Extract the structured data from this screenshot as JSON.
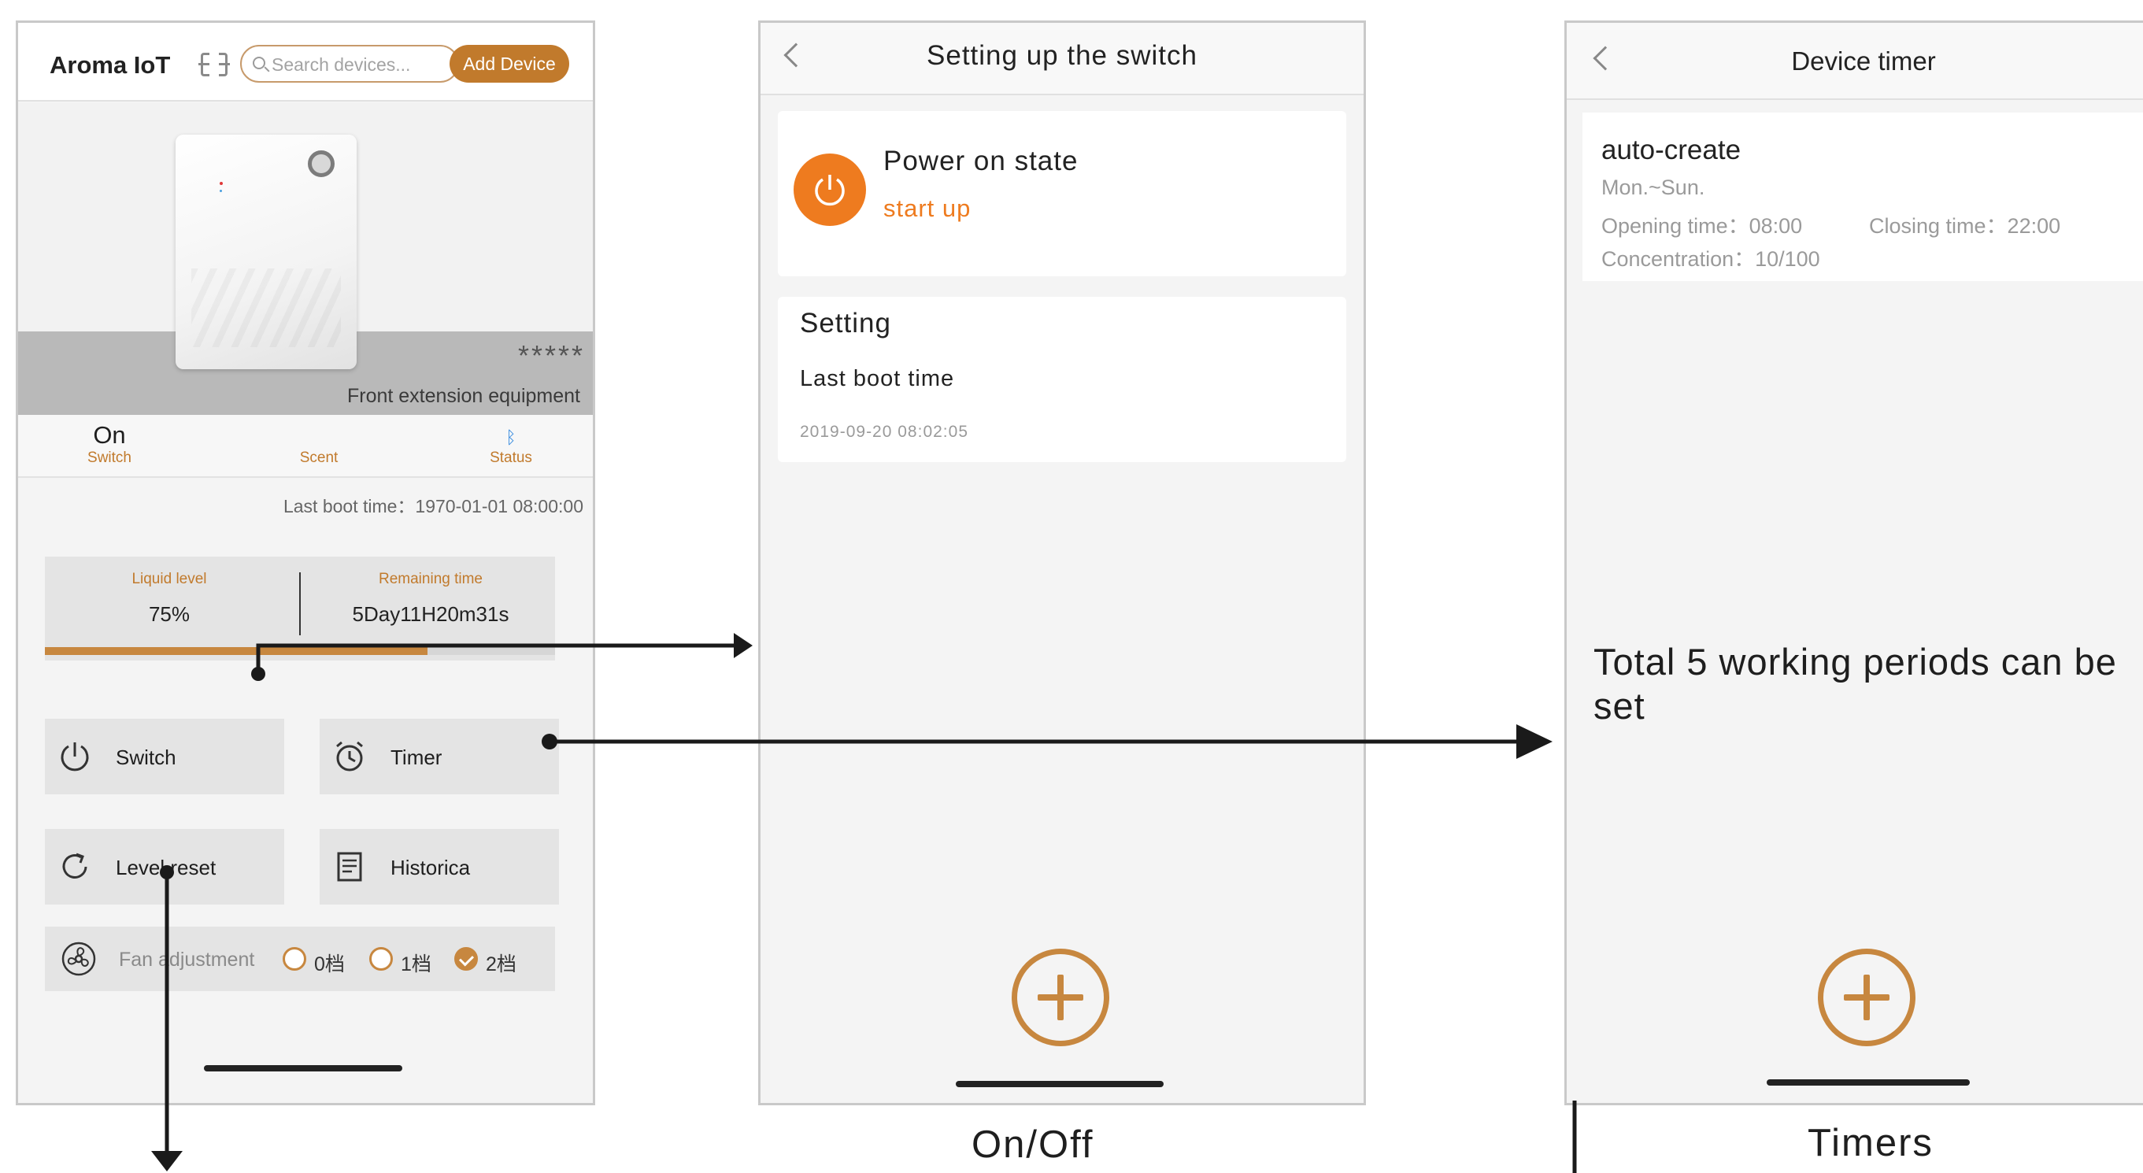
{
  "phone1": {
    "app_title": "Aroma IoT",
    "search_placeholder": "Search devices...",
    "add_device_label": "Add Device",
    "device_stars": "*****",
    "device_subtitle": "Front extension equipment",
    "tabs": [
      {
        "value": "On",
        "label": "Switch"
      },
      {
        "value": "",
        "label": "Scent"
      },
      {
        "icon": "bluetooth-icon",
        "label": "Status"
      }
    ],
    "last_boot_text": "Last boot time：1970-01-01 08:00:00",
    "liquid_level_label": "Liquid level",
    "liquid_level_value": "75%",
    "liquid_level_fraction": 0.75,
    "remaining_time_label": "Remaining time",
    "remaining_time_value": "5Day11H20m31s",
    "buttons": {
      "switch": "Switch",
      "timer": "Timer",
      "level_reset": "Level reset",
      "historica": "Historica"
    },
    "fan": {
      "label": "Fan adjustment",
      "options": [
        "0档",
        "1档",
        "2档"
      ],
      "selected": "2档"
    }
  },
  "phone2": {
    "title": "Setting up the switch",
    "power_title": "Power on state",
    "power_value": "start up",
    "setting_title": "Setting",
    "last_boot_label": "Last boot time",
    "last_boot_value": "2019-09-20  08:02:05"
  },
  "phone3": {
    "title": "Device timer",
    "timer_name": "auto-create",
    "days": "Mon.~Sun.",
    "opening_time": "Opening time：08:00",
    "closing_time": "Closing time：22:00",
    "concentration": "Concentration：10/100",
    "note": "Total 5 working periods can be set"
  },
  "captions": {
    "onoff": "On/Off",
    "timers": "Timers"
  },
  "colors": {
    "accent": "#c17a2c",
    "power_orange": "#ee7b1f",
    "bluetooth": "#3a8de0"
  }
}
